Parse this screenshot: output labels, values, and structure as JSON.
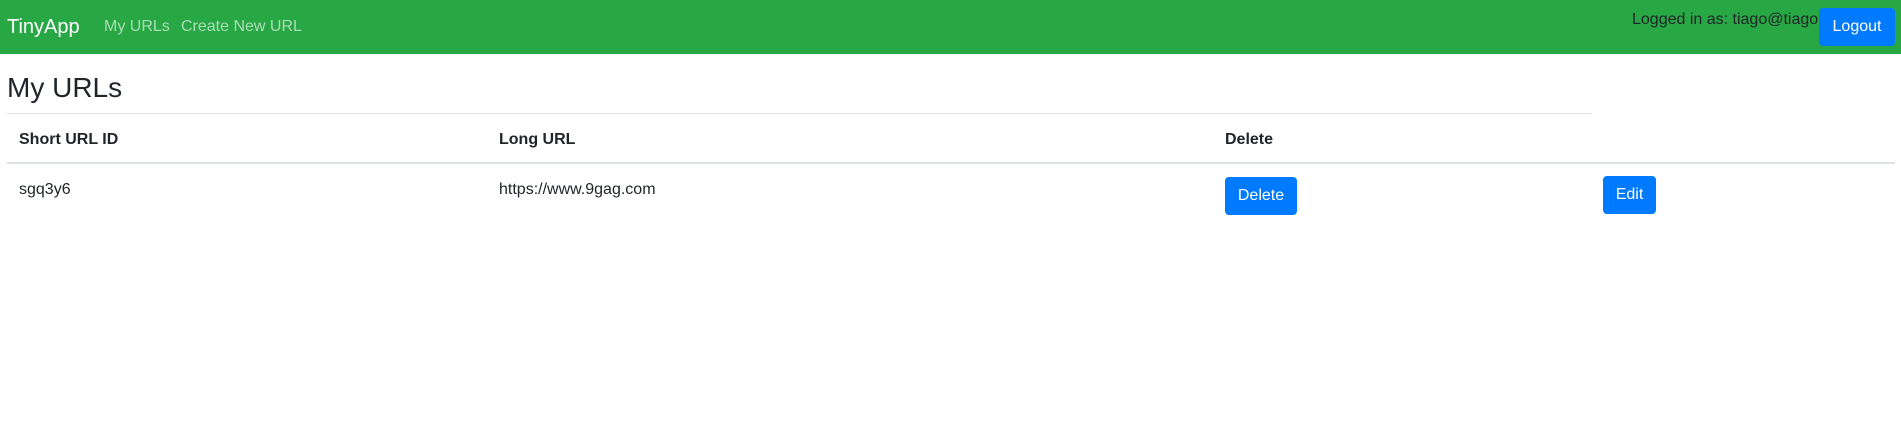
{
  "navbar": {
    "brand": "TinyApp",
    "links": [
      "My URLs",
      "Create New URL"
    ],
    "login_text": "Logged in as: tiago@tiago",
    "logout_label": "Logout",
    "background_color": "#28a745"
  },
  "main": {
    "title": "My URLs",
    "table": {
      "headers": [
        "Short URL ID",
        "Long URL",
        "Delete"
      ],
      "rows": [
        {
          "short_id": "sgq3y6",
          "long_url": "https://www.9gag.com",
          "delete_label": "Delete",
          "edit_label": "Edit"
        }
      ]
    }
  },
  "colors": {
    "primary_button": "#007bff"
  }
}
